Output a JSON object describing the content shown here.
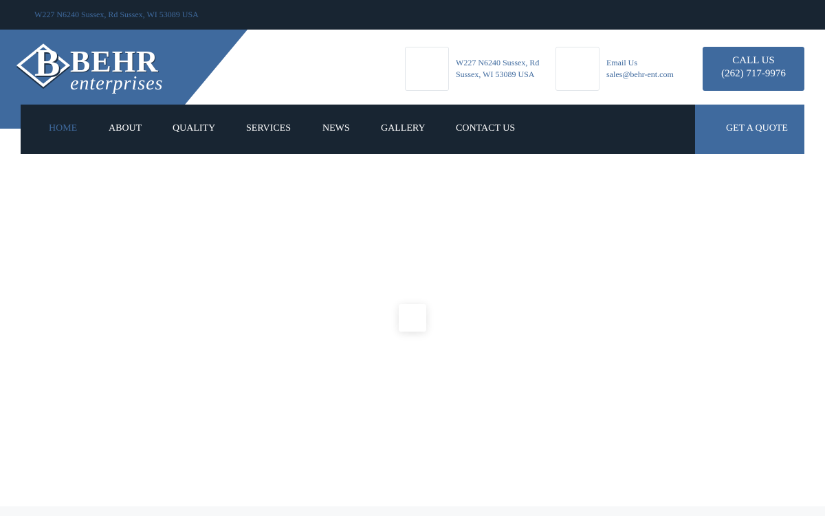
{
  "topbar": {
    "address": "W227 N6240 Sussex, Rd Sussex, WI 53089 USA"
  },
  "brand": {
    "initial": "B",
    "name": "BEHR",
    "tagline": "enterprises"
  },
  "contact": {
    "address_line1": "W227 N6240 Sussex, Rd",
    "address_line2": "Sussex, WI 53089 USA",
    "email_label": "Email Us",
    "email": "sales@behr-ent.com",
    "call_label": "CALL US",
    "phone": "(262) 717-9976"
  },
  "nav": {
    "items": [
      {
        "label": "HOME",
        "active": true
      },
      {
        "label": "ABOUT"
      },
      {
        "label": "QUALITY"
      },
      {
        "label": "SERVICES"
      },
      {
        "label": "NEWS"
      },
      {
        "label": "GALLERY"
      },
      {
        "label": "CONTACT US"
      }
    ],
    "quote_label": "GET A QUOTE"
  },
  "colors": {
    "dark": "#182532",
    "accent": "#3f6a9e",
    "white": "#ffffff"
  }
}
